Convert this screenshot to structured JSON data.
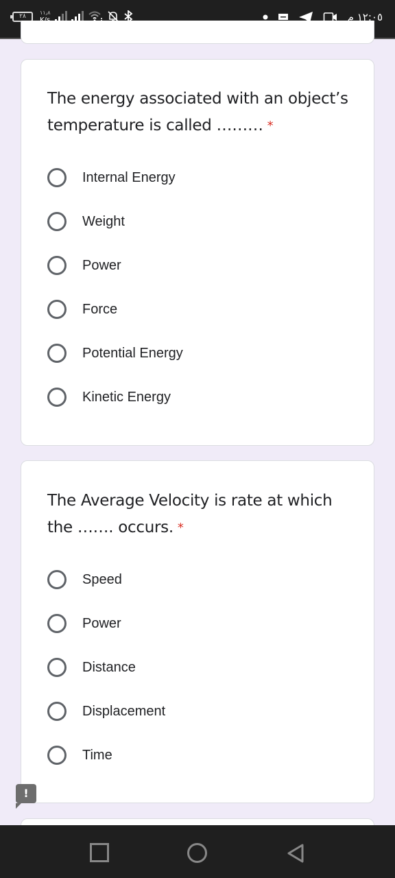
{
  "status_bar": {
    "battery_level": "٢٨",
    "net_speed_value": "١١٫٨",
    "net_speed_unit": "K/s",
    "clock": "١٢:٠٥ م",
    "icons": [
      "battery-icon",
      "signal-icon",
      "signal-icon",
      "wifi-icon",
      "bell-off-icon",
      "bluetooth-icon",
      "dot-icon",
      "message-icon",
      "telegram-icon",
      "video-camera-icon"
    ]
  },
  "form": {
    "required_marker": "*",
    "questions": [
      {
        "title": "The energy associated with an object’s temperature is called ………",
        "required": true,
        "options": [
          "Internal Energy",
          "Weight",
          "Power",
          "Force",
          "Potential Energy",
          "Kinetic Energy"
        ]
      },
      {
        "title": "The Average Velocity is rate at which the ……. occurs.",
        "required": true,
        "options": [
          "Speed",
          "Power",
          "Distance",
          "Displacement",
          "Time"
        ]
      }
    ],
    "feedback_icon_glyph": "!"
  },
  "nav_bar": {
    "buttons": [
      "recents",
      "home",
      "back"
    ]
  },
  "colors": {
    "background": "#f0ebf8",
    "required": "#d93025",
    "text": "#202124",
    "radio_border": "#5f6368",
    "system_bar": "#1f1f1f"
  }
}
